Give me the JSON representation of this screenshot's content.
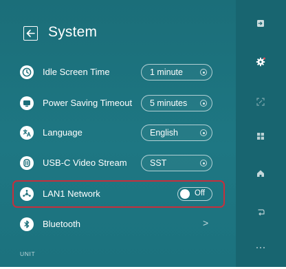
{
  "header": {
    "title": "System"
  },
  "settings": [
    {
      "icon": "clock-icon",
      "label": "Idle Screen Time",
      "control": "select",
      "value": "1 minute"
    },
    {
      "icon": "monitor-power-icon",
      "label": "Power Saving Timeout",
      "control": "select",
      "value": "5 minutes"
    },
    {
      "icon": "translate-icon",
      "label": "Language",
      "control": "select",
      "value": "English"
    },
    {
      "icon": "usb-c-icon",
      "label": "USB-C Video Stream",
      "control": "select",
      "value": "SST"
    },
    {
      "icon": "network-hub-icon",
      "label": "LAN1 Network",
      "control": "toggle",
      "value": "Off",
      "highlighted": true
    },
    {
      "icon": "bluetooth-icon",
      "label": "Bluetooth",
      "control": "chevron",
      "value": ">"
    }
  ],
  "footer": {
    "section_label": "UNIT"
  },
  "side_rail": [
    {
      "icon": "input-source-icon",
      "active": false
    },
    {
      "icon": "settings-gear-icon",
      "active": true
    },
    {
      "icon": "screen-share-icon",
      "active": false
    },
    {
      "icon": "apps-grid-icon",
      "active": false
    },
    {
      "icon": "home-icon",
      "active": false
    },
    {
      "icon": "return-icon",
      "active": false
    },
    {
      "icon": "more-dots-icon",
      "active": false
    }
  ],
  "colors": {
    "panel_bg": "#1b6e79",
    "rail_bg": "#186570",
    "highlight_border": "#c72f3c",
    "notification_dot": "#e0505a"
  }
}
